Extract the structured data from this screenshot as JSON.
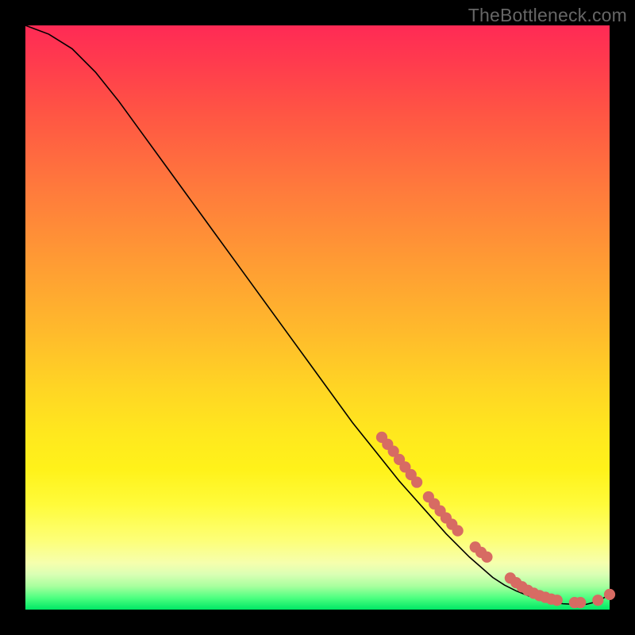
{
  "watermark": "TheBottleneck.com",
  "colors": {
    "background": "#000000",
    "curve": "#000000",
    "marker": "#d76b63",
    "gradient_stops": [
      "#ff2a55",
      "#ff3a4e",
      "#ff5544",
      "#ff7a3c",
      "#ff9a34",
      "#ffb92c",
      "#ffd524",
      "#ffe81e",
      "#fff21a",
      "#fffb3a",
      "#fdff76",
      "#f6ffad",
      "#d9ffb4",
      "#a8ff9e",
      "#4dff80",
      "#00e765"
    ]
  },
  "chart_data": {
    "type": "line",
    "title": "",
    "xlabel": "",
    "ylabel": "",
    "xlim": [
      0,
      100
    ],
    "ylim": [
      0,
      100
    ],
    "grid": false,
    "legend": false,
    "series": [
      {
        "name": "curve",
        "x": [
          0,
          4,
          8,
          12,
          16,
          20,
          24,
          28,
          32,
          36,
          40,
          44,
          48,
          52,
          56,
          60,
          64,
          68,
          72,
          76,
          80,
          82,
          84,
          86,
          88,
          90,
          92,
          94,
          96,
          98,
          100
        ],
        "y": [
          100,
          98.5,
          96,
          92,
          87,
          81.5,
          76,
          70.5,
          65,
          59.5,
          54,
          48.5,
          43,
          37.5,
          32,
          27,
          22,
          17.5,
          13,
          9,
          5.5,
          4.2,
          3.2,
          2.4,
          1.8,
          1.3,
          1.0,
          0.9,
          0.9,
          1.4,
          2.6
        ]
      }
    ],
    "markers": [
      {
        "x": 61,
        "y": 29.5
      },
      {
        "x": 62,
        "y": 28.3
      },
      {
        "x": 63,
        "y": 27.1
      },
      {
        "x": 64,
        "y": 25.7
      },
      {
        "x": 65,
        "y": 24.4
      },
      {
        "x": 66,
        "y": 23.1
      },
      {
        "x": 67,
        "y": 21.8
      },
      {
        "x": 69,
        "y": 19.3
      },
      {
        "x": 70,
        "y": 18.1
      },
      {
        "x": 71,
        "y": 16.9
      },
      {
        "x": 72,
        "y": 15.7
      },
      {
        "x": 73,
        "y": 14.6
      },
      {
        "x": 74,
        "y": 13.5
      },
      {
        "x": 77,
        "y": 10.7
      },
      {
        "x": 78,
        "y": 9.8
      },
      {
        "x": 79,
        "y": 9.0
      },
      {
        "x": 83,
        "y": 5.4
      },
      {
        "x": 84,
        "y": 4.6
      },
      {
        "x": 85,
        "y": 3.9
      },
      {
        "x": 86,
        "y": 3.3
      },
      {
        "x": 87,
        "y": 2.8
      },
      {
        "x": 88,
        "y": 2.4
      },
      {
        "x": 89,
        "y": 2.1
      },
      {
        "x": 90,
        "y": 1.8
      },
      {
        "x": 91,
        "y": 1.6
      },
      {
        "x": 94,
        "y": 1.2
      },
      {
        "x": 95,
        "y": 1.2
      },
      {
        "x": 98,
        "y": 1.6
      },
      {
        "x": 100,
        "y": 2.6
      }
    ],
    "marker_radius_data_units": 0.9
  }
}
